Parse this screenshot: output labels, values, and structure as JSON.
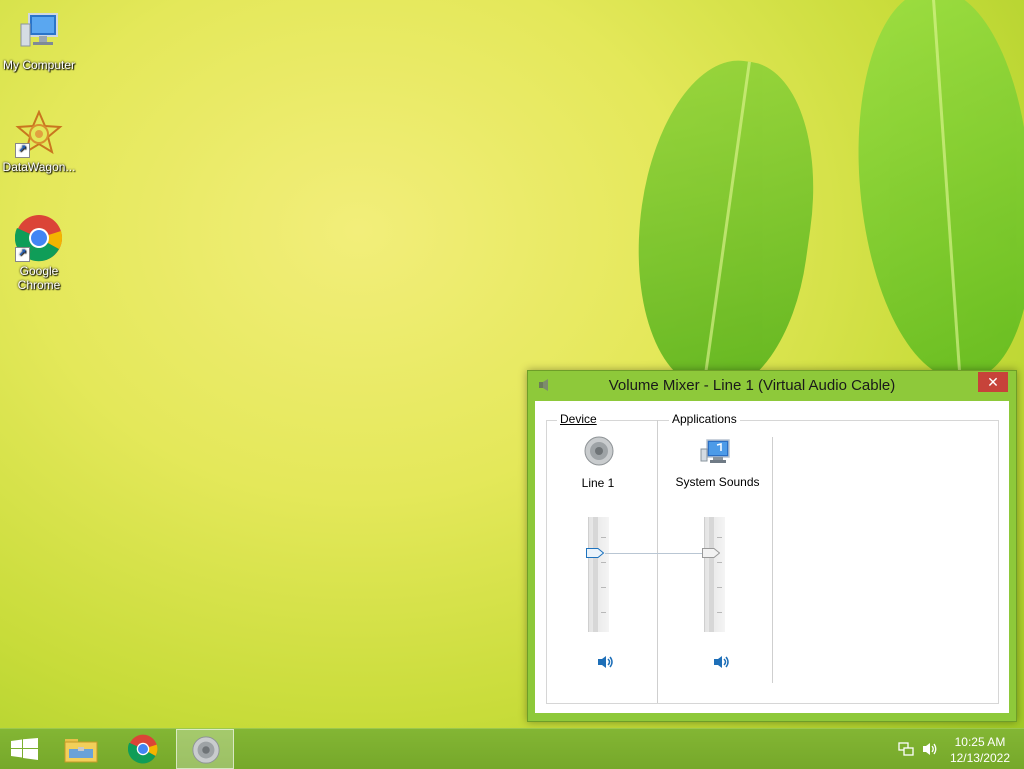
{
  "desktop": {
    "icons": [
      {
        "label": "My Computer",
        "icon": "computer-icon"
      },
      {
        "label": "DataWagon...",
        "icon": "datawagon-icon"
      },
      {
        "label": "Google Chrome",
        "label_line1": "Google",
        "label_line2": "Chrome",
        "icon": "chrome-icon"
      }
    ]
  },
  "window": {
    "title": "Volume Mixer - Line 1 (Virtual Audio Cable)",
    "close_label": "✕",
    "sections": {
      "device_label": "Device",
      "applications_label": "Applications"
    },
    "channels": [
      {
        "name": "Line 1",
        "icon": "speaker-icon",
        "volume_fraction": 0.7,
        "mute_icon": "volume-icon"
      },
      {
        "name": "System Sounds",
        "icon": "system-sounds-icon",
        "volume_fraction": 0.7,
        "mute_icon": "volume-icon"
      }
    ]
  },
  "taskbar": {
    "buttons": [
      {
        "name": "start",
        "icon": "windows-logo-icon"
      },
      {
        "name": "file-explorer",
        "icon": "folder-icon"
      },
      {
        "name": "chrome",
        "icon": "chrome-icon"
      },
      {
        "name": "volume-mixer",
        "icon": "speaker-icon",
        "active": true
      }
    ],
    "tray": {
      "network_icon": "network-icon",
      "volume_icon": "volume-icon",
      "time": "10:25 AM",
      "date": "12/13/2022"
    }
  },
  "colors": {
    "window_frame": "#8ec93a",
    "taskbar": "#7aac2e",
    "close_button": "#c7433a",
    "slider_thumb_device": "#1e73be"
  }
}
